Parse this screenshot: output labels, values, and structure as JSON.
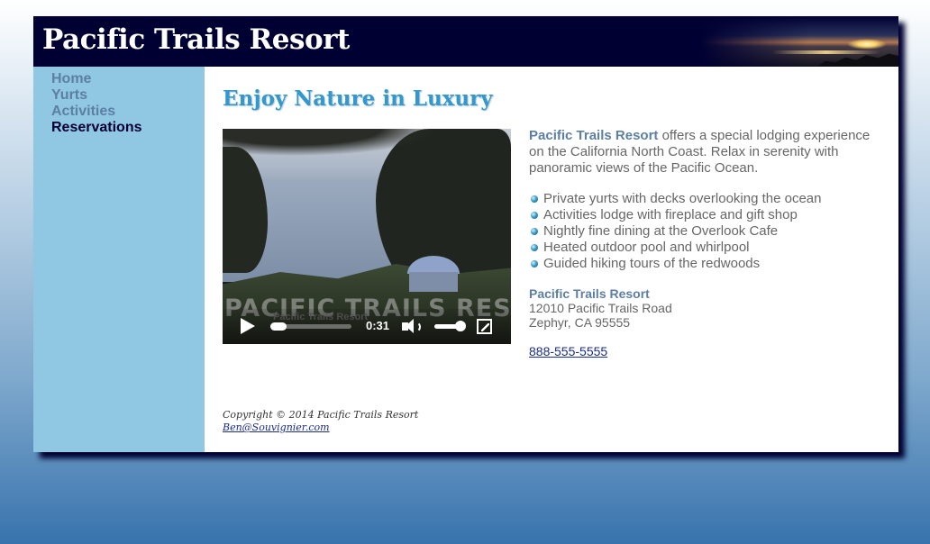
{
  "header": {
    "title": "Pacific Trails Resort"
  },
  "nav": {
    "items": [
      {
        "label": "Home"
      },
      {
        "label": "Yurts"
      },
      {
        "label": "Activities"
      },
      {
        "label": "Reservations"
      }
    ]
  },
  "main": {
    "heading": "Enjoy Nature in Luxury",
    "video": {
      "watermark": "PACIFIC TRAILS RESORT",
      "label": "Pacific Trails Resort",
      "time": "0:31"
    },
    "intro": {
      "brand": "Pacific Trails Resort",
      "text": " offers a special lodging experience on the California North Coast. Relax in serenity with panoramic views of the Pacific Ocean."
    },
    "features": [
      "Private yurts with decks overlooking the ocean",
      "Activities lodge with fireplace and gift shop",
      "Nightly fine dining at the Overlook Cafe",
      "Heated outdoor pool and whirlpool",
      "Guided hiking tours of the redwoods"
    ],
    "address": {
      "name": "Pacific Trails Resort",
      "street": "12010 Pacific Trails Road",
      "city": "Zephyr, CA 95555"
    },
    "phone": "888-555-5555"
  },
  "footer": {
    "copyright": "Copyright © 2014 Pacific Trails Resort",
    "email": "Ben@Souvignier.com"
  },
  "colors": {
    "header_bg": "#000033",
    "nav_bg": "#90c7e3",
    "heading": "#3399cc",
    "brand": "#5c7fa3"
  }
}
